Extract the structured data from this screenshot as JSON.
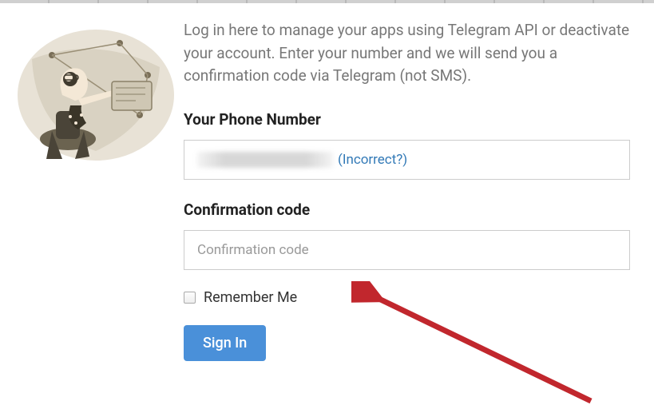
{
  "description": "Log in here to manage your apps using Telegram API or deactivate your account. Enter your number and we will send you a confirmation code via Telegram (not SMS).",
  "phone": {
    "label": "Your Phone Number",
    "incorrect_link": "(Incorrect?)"
  },
  "code": {
    "label": "Confirmation code",
    "placeholder": "Confirmation code"
  },
  "remember": {
    "label": "Remember Me"
  },
  "signin_label": "Sign In",
  "colors": {
    "primary": "#4a90d9",
    "link": "#337ab7",
    "text_muted": "#777777",
    "arrow": "#c1272d"
  }
}
